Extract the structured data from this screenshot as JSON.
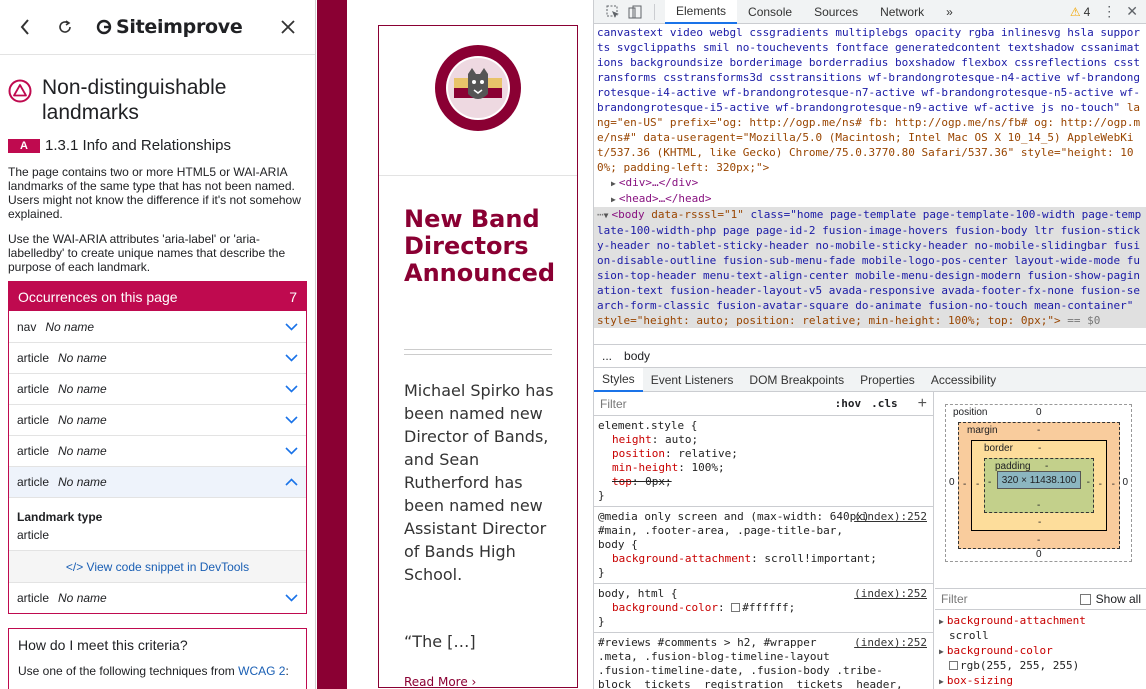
{
  "siteimprove": {
    "logo_text": "Siteimprove",
    "issue_title": "Non-distinguishable landmarks",
    "criterion_level": "A",
    "criterion_text": "1.3.1 Info and Relationships",
    "description_1": "The page contains two or more HTML5 or WAI-ARIA landmarks of the same type that has not been named. Users might not know the difference if it's not somehow explained.",
    "description_2": "Use the WAI-ARIA attributes 'aria-label' or 'aria-labelledby' to create unique names that describe the purpose of each landmark.",
    "occurrences": {
      "title": "Occurrences on this page",
      "count": "7",
      "rows": [
        {
          "tag": "nav",
          "name": "No name"
        },
        {
          "tag": "article",
          "name": "No name"
        },
        {
          "tag": "article",
          "name": "No name"
        },
        {
          "tag": "article",
          "name": "No name"
        },
        {
          "tag": "article",
          "name": "No name"
        },
        {
          "tag": "article",
          "name": "No name"
        },
        {
          "tag": "article",
          "name": "No name"
        }
      ],
      "detail_label": "Landmark type",
      "detail_value": "article",
      "snippet_link": "</> View code snippet in DevTools"
    },
    "how": {
      "title": "How do I meet this criteria?",
      "text_prefix": "Use one of the following techniques from ",
      "link": "WCAG 2",
      "text_suffix": ":"
    }
  },
  "webpage": {
    "title": "New Band Directors Announced",
    "body": "Michael Spirko has been named new Director of Bands, and Sean Rutherford has been named new Assistant Director of Bands High School.",
    "quote": "“The […]",
    "read_more": "Read More ›"
  },
  "devtools": {
    "tabs": [
      "Elements",
      "Console",
      "Sources",
      "Network"
    ],
    "more_tabs": "»",
    "warning_count": "4",
    "dom": {
      "html_classes": "canvastext video webgl cssgradients multiplebgs opacity rgba inlinesvg hsla supports svgclippaths smil no-touchevents fontface generatedcontent textshadow cssanimations backgroundsize borderimage borderradius boxshadow flexbox cssreflections csstransforms csstransforms3d csstransitions wf-brandongrotesque-n4-active wf-brandongrotesque-i4-active wf-brandongrotesque-n7-active wf-brandongrotesque-n5-active wf-brandongrotesque-i5-active wf-brandongrotesque-n9-active wf-active js no-touch\"",
      "html_lang": "lang=\"en-US\"",
      "html_prefix": "prefix=\"og: http://ogp.me/ns# fb: http://ogp.me/ns/fb# og: http://ogp.me/ns#\"",
      "html_ua": "data-useragent=\"Mozilla/5.0 (Macintosh; Intel Mac OS X 10_14_5) AppleWebKit/537.36 (KHTML, like Gecko) Chrome/75.0.3770.80 Safari/537.36\"",
      "html_style": "style=\"height: 100%; padding-left: 320px;\">",
      "div_line": "<div>…</div>",
      "head_line": "<head>…</head>",
      "body_open": "<body",
      "body_rsssl": "data-rsssl=\"1\"",
      "body_class": "class=\"home page-template page-template-100-width page-template-100-width-php page page-id-2 fusion-image-hovers fusion-body ltr fusion-sticky-header no-tablet-sticky-header no-mobile-sticky-header no-mobile-slidingbar fusion-disable-outline fusion-sub-menu-fade mobile-logo-pos-center layout-wide-mode fusion-top-header menu-text-align-center mobile-menu-design-modern fusion-show-pagination-text fusion-header-layout-v5 avada-responsive avada-footer-fx-none fusion-search-form-classic fusion-avatar-square do-animate fusion-no-touch mean-container\"",
      "body_style": "style=\"height: auto; position: relative; min-height: 100%; top: 0px;\">",
      "body_ref": "== $0"
    },
    "breadcrumb": [
      "...",
      "body"
    ],
    "subtabs": [
      "Styles",
      "Event Listeners",
      "DOM Breakpoints",
      "Properties",
      "Accessibility"
    ],
    "styles": {
      "filter_placeholder": "Filter",
      "hov": ":hov",
      "cls": ".cls",
      "rules": [
        {
          "selector": "element.style {",
          "source": "",
          "props": [
            {
              "name": "height",
              "value": "auto;",
              "strike": false
            },
            {
              "name": "position",
              "value": "relative;",
              "strike": false
            },
            {
              "name": "min-height",
              "value": "100%;",
              "strike": false
            },
            {
              "name": "top",
              "value": "0px;",
              "strike": true
            }
          ]
        },
        {
          "selector": "@media only screen and (max-width: 640px)\n#main, .footer-area, .page-title-bar,\nbody {",
          "source": "(index):252",
          "props": [
            {
              "name": "background-attachment",
              "value": "scroll!important;",
              "strike": false
            }
          ]
        },
        {
          "selector": "body, html {",
          "source": "(index):252",
          "props": [
            {
              "name": "background-color",
              "value": "#ffffff;",
              "strike": false,
              "swatch": "#ffffff"
            }
          ]
        },
        {
          "selector": "#reviews #comments > h2, #wrapper\n.meta, .fusion-blog-timeline-layout\n.fusion-timeline-date, .fusion-body .tribe-\nblock__tickets__registration__tickets__header,",
          "source": "(index):252",
          "props": []
        }
      ]
    },
    "boxmodel": {
      "position_label": "position",
      "position_value": "0",
      "margin_label": "margin",
      "border_label": "border",
      "padding_label": "padding",
      "dash": "-",
      "content": "320 × 11438.100",
      "outer_left": "0",
      "outer_right": "0",
      "outer_bottom": "0"
    },
    "computed": {
      "filter_placeholder": "Filter",
      "show_all": "Show all",
      "items": [
        {
          "name": "background-attachment",
          "value": "scroll"
        },
        {
          "name": "background-color",
          "value": "rgb(255, 255, 255)",
          "swatch": "#ffffff"
        },
        {
          "name": "box-sizing",
          "value": ""
        }
      ]
    }
  },
  "colors": {
    "siteimprove_accent": "#bf0a4f",
    "site_brand": "#8a0033",
    "devtools_active_tab": "#1a73e8"
  }
}
